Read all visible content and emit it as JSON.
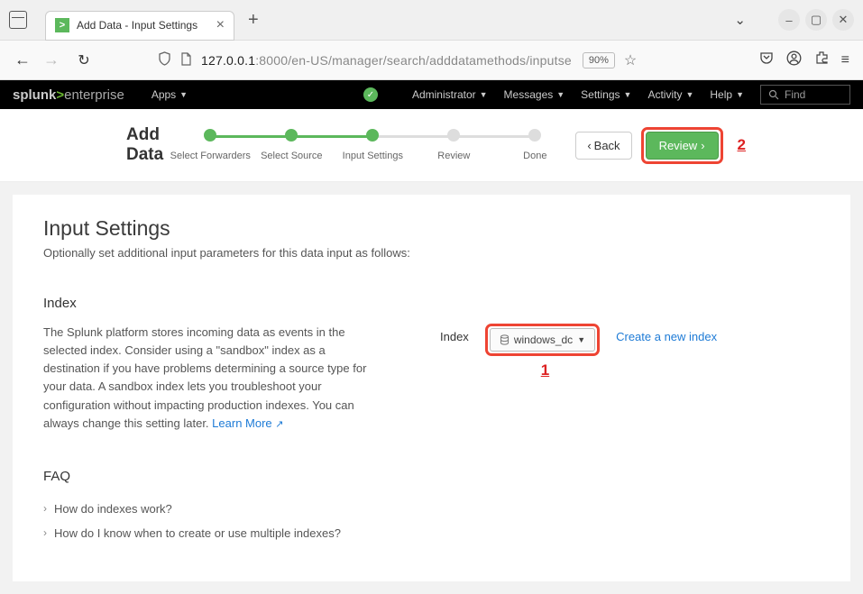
{
  "browser": {
    "tab_title": "Add Data - Input Settings",
    "url_prefix": "127.0.0.1",
    "url_suffix": ":8000/en-US/manager/search/adddatamethods/inputse",
    "zoom": "90%"
  },
  "splunk": {
    "logo_a": "splunk",
    "logo_b": "enterprise",
    "apps": "Apps",
    "admin": "Administrator",
    "messages": "Messages",
    "settings": "Settings",
    "activity": "Activity",
    "help": "Help",
    "find_placeholder": "Find"
  },
  "wizard": {
    "title": "Add Data",
    "steps": [
      "Select Forwarders",
      "Select Source",
      "Input Settings",
      "Review",
      "Done"
    ],
    "back": "Back",
    "review": "Review"
  },
  "annotations": {
    "one": "1",
    "two": "2"
  },
  "page": {
    "h1": "Input Settings",
    "subtitle": "Optionally set additional input parameters for this data input as follows:",
    "index_h": "Index",
    "index_desc": "The Splunk platform stores incoming data as events in the selected index. Consider using a \"sandbox\" index as a destination if you have problems determining a source type for your data. A sandbox index lets you troubleshoot your configuration without impacting production indexes. You can always change this setting later. ",
    "learn_more": "Learn More",
    "index_label": "Index",
    "index_value": "windows_dc",
    "create_link": "Create a new index",
    "faq_h": "FAQ",
    "faq1": "How do indexes work?",
    "faq2": "How do I know when to create or use multiple indexes?"
  }
}
